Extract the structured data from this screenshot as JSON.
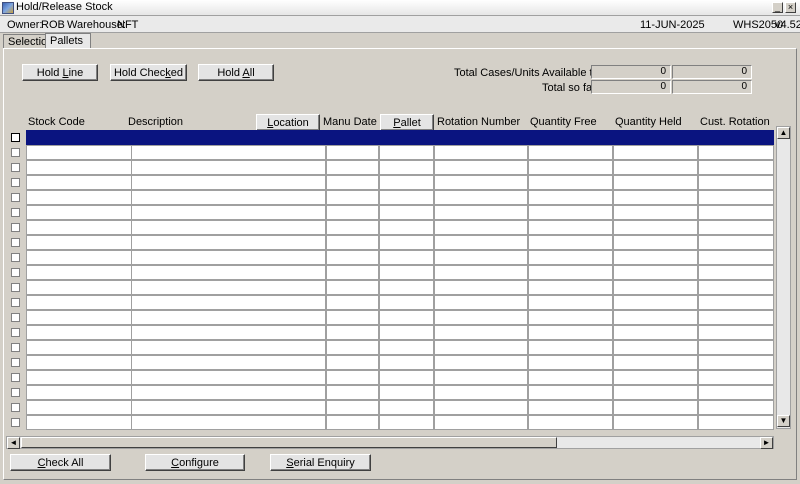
{
  "window": {
    "title": "Hold/Release Stock",
    "minimize": "_",
    "close": "×"
  },
  "info": {
    "owner_label": "Owner:",
    "owner": "ROB",
    "warehouse_label": "Warehouse:",
    "warehouse": "NFT",
    "date": "11-JUN-2025",
    "module": "WHS2050",
    "version": "v4.52"
  },
  "tabs": [
    "Selection",
    "Pallets"
  ],
  "actions": {
    "hold_line_pre": "Hold ",
    "hold_line_key": "L",
    "hold_line_post": "ine",
    "hold_checked_pre": "Hold Chec",
    "hold_checked_key": "k",
    "hold_checked_post": "ed",
    "hold_all_pre": "Hold ",
    "hold_all_key": "A",
    "hold_all_post": "ll"
  },
  "totals": {
    "available_label": "Total Cases/Units Available to Hold:",
    "available_cases": "0",
    "available_units": "0",
    "so_far_label": "Total so far:",
    "so_far_cases": "0",
    "so_far_units": "0"
  },
  "columns": {
    "stock_code": "Stock Code",
    "description": "Description",
    "location_pre": "",
    "location_key": "L",
    "location_post": "ocation",
    "manu_date": "Manu Date",
    "pallet_pre": "",
    "pallet_key": "P",
    "pallet_post": "allet",
    "rotation_number": "Rotation Number",
    "quantity_free": "Quantity Free",
    "quantity_held": "Quantity Held",
    "cust_rotation": "Cust. Rotation"
  },
  "footer": {
    "check_all_pre": "",
    "check_all_key": "C",
    "check_all_post": "heck All",
    "configure_pre": "",
    "configure_key": "C",
    "configure_post": "onfigure",
    "serial_enquiry_pre": "",
    "serial_enquiry_key": "S",
    "serial_enquiry_post": "erial Enquiry"
  },
  "scrollbars": {
    "up": "▲",
    "down": "▼",
    "left": "◄",
    "right": "►"
  }
}
